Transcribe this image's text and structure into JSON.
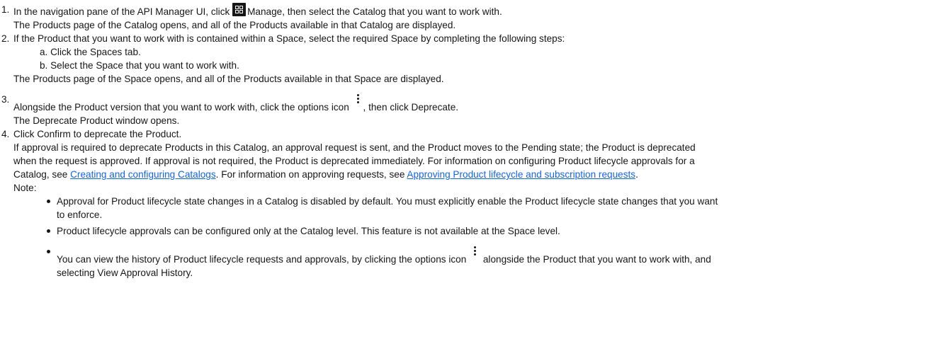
{
  "steps": [
    {
      "num": "1.",
      "a": "In the navigation pane of the API Manager UI, click",
      "icon": "grid-manage-icon",
      "b": "Manage, then select the Catalog that you want to work with.",
      "c": "The Products page of the Catalog opens, and all of the Products available in that Catalog are displayed."
    },
    {
      "num": "2.",
      "a": "If the Product that you want to work with is contained within a Space, select the required Space by completing the following steps:",
      "sub_a": "a. Click the Spaces tab.",
      "sub_b": "b. Select the Space that you want to work with.",
      "c": "The Products page of the Space opens, and all of the Products available in that Space are displayed."
    },
    {
      "num": "3.",
      "a": "Alongside the Product version that you want to work with, click the options icon",
      "icon": "options-kebab-icon",
      "b": ", then click Deprecate.",
      "c": "The Deprecate Product window opens."
    },
    {
      "num": "4.",
      "a": "Click Confirm to deprecate the Product.",
      "p1": "If approval is required to deprecate Products in this Catalog, an approval request is sent, and the Product moves to the Pending state; the Product is deprecated",
      "p2": "when the request is approved. If approval is not required, the Product is deprecated immediately. For information on configuring Product lifecycle approvals for a",
      "p3_a": "Catalog, see",
      "link1": "Creating and configuring Catalogs",
      "p3_b": ". For information on approving requests, see",
      "link2": "Approving Product lifecycle and subscription requests",
      "p3_c": ".",
      "note": "Note:",
      "bullet1_a": "Approval for Product lifecycle state changes in a Catalog is disabled by default. You must explicitly enable the Product lifecycle state changes that you want",
      "bullet1_b": "to enforce.",
      "bullet2": "Product lifecycle approvals can be configured only at the Catalog level. This feature is not available at the Space level.",
      "bullet3_a": "You can view the history of Product lifecycle requests and approvals, by clicking the options icon",
      "bullet3_b": "alongside the Product that you want to work with, and",
      "bullet3_c": "selecting View Approval History."
    }
  ]
}
